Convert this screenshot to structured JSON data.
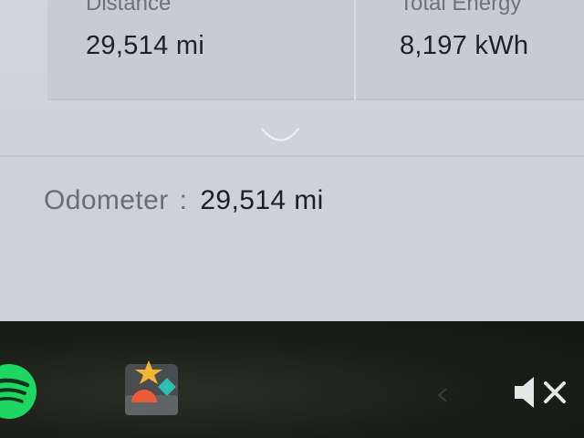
{
  "stats": {
    "distance_label": "Distance",
    "distance_value": "29,514 mi",
    "energy_label": "Total Energy",
    "energy_value": "8,197 kWh"
  },
  "odometer": {
    "label": "Odometer",
    "separator": ":",
    "value": "29,514 mi"
  },
  "dock": {
    "apps": [
      {
        "icon": "spotify-icon",
        "color": "#1ed760"
      },
      {
        "icon": "toybox-icon",
        "color": "#f2b632"
      }
    ],
    "volume": {
      "icon": "volume-mute-icon",
      "state": "muted"
    }
  },
  "colors": {
    "screen_bg": "#cfd2d9",
    "card_bg": "#c8cbd2",
    "text_primary": "#1f2125",
    "text_secondary": "#6f7278"
  }
}
